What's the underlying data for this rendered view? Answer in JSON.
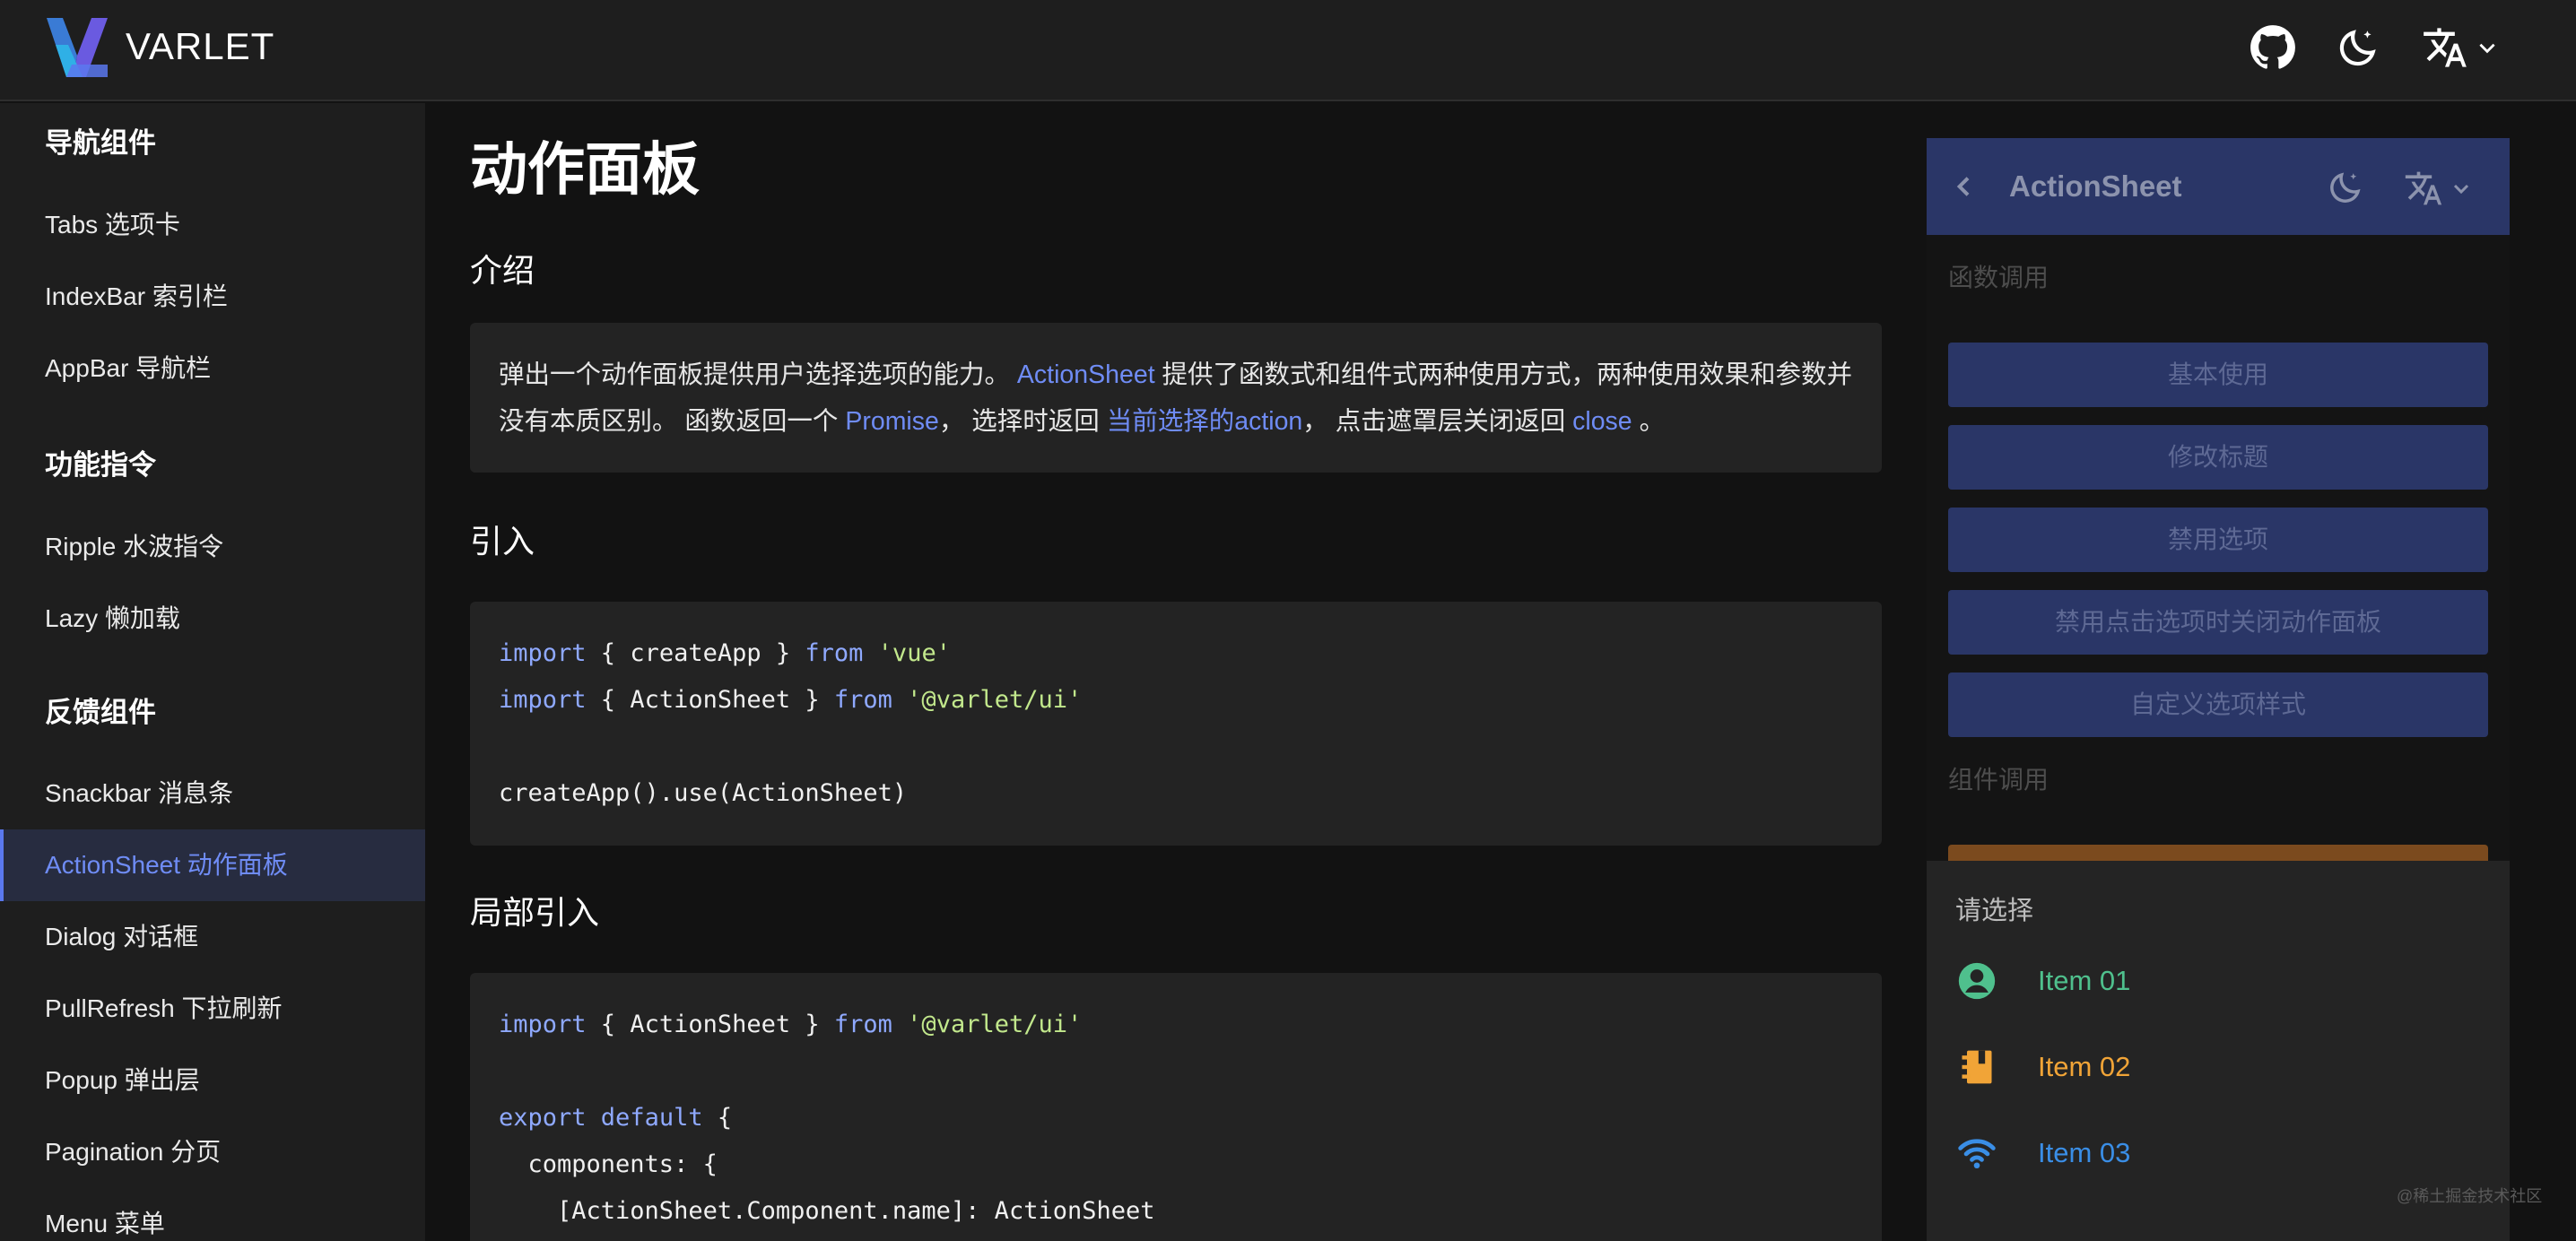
{
  "header": {
    "brand": "VARLET",
    "icons": [
      "github-icon",
      "moon-icon",
      "translate-icon",
      "chevron-down-icon"
    ]
  },
  "sidebar": {
    "groups": [
      {
        "title": "导航组件",
        "items": [
          "Tabs 选项卡",
          "IndexBar 索引栏",
          "AppBar 导航栏"
        ]
      },
      {
        "title": "功能指令",
        "items": [
          "Ripple 水波指令",
          "Lazy 懒加载"
        ]
      },
      {
        "title": "反馈组件",
        "items": [
          "Snackbar 消息条",
          "ActionSheet 动作面板",
          "Dialog 对话框",
          "PullRefresh 下拉刷新",
          "Popup 弹出层",
          "Pagination 分页",
          "Menu 菜单"
        ]
      }
    ],
    "active_item": "ActionSheet 动作面板"
  },
  "content": {
    "title": "动作面板",
    "intro_heading": "介绍",
    "intro": {
      "t1": "弹出一个动作面板提供用户选择选项的能力。 ",
      "l1": "ActionSheet",
      "t2": " 提供了函数式和组件式两种使用方式，两种使用效果和参数并没有本质区别。 函数返回一个 ",
      "l2": "Promise",
      "t3": "， 选择时返回 ",
      "l3": "当前选择的action",
      "t4": "， 点击遮罩层关闭返回 ",
      "l4": "close",
      "t5": " 。"
    },
    "import_heading": "引入",
    "import_code": {
      "line1": {
        "kw1": "import",
        "mid": " { createApp } ",
        "kw2": "from",
        "str": " 'vue'"
      },
      "line2": {
        "kw1": "import",
        "mid": " { ActionSheet } ",
        "kw2": "from",
        "str": " '@varlet/ui'"
      },
      "line3": "createApp().use(ActionSheet)"
    },
    "local_heading": "局部引入",
    "local_code": {
      "line1": {
        "kw1": "import",
        "mid": " { ActionSheet } ",
        "kw2": "from",
        "str": " '@varlet/ui'"
      },
      "line2": {
        "kw1": "export",
        "kw2": " default",
        "rest": " {"
      },
      "line3": "  components: {",
      "line4": "    [ActionSheet.Component.name]: ActionSheet"
    }
  },
  "phone": {
    "title": "ActionSheet",
    "section1": "函数调用",
    "buttons": [
      "基本使用",
      "修改标题",
      "禁用选项",
      "禁用点击选项时关闭动作面板",
      "自定义选项样式"
    ],
    "section2": "组件调用",
    "sheet": {
      "title": "请选择",
      "items": [
        {
          "label": "Item 01",
          "icon": "account-circle-icon",
          "color": "#4fc08d"
        },
        {
          "label": "Item 02",
          "icon": "notebook-icon",
          "color": "#f1a437"
        },
        {
          "label": "Item 03",
          "icon": "wifi-icon",
          "color": "#3a8ee6"
        }
      ]
    }
  },
  "watermark": "@稀土掘金技术社区",
  "colors": {
    "accent": "#6f8cf5",
    "background": "#121212",
    "surface": "#1e1e1e",
    "card": "#232323",
    "phone_primary": "#2a3667"
  }
}
